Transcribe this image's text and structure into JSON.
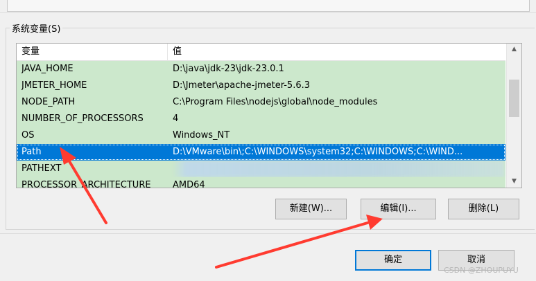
{
  "group_label": "系统变量(S)",
  "columns": {
    "variable": "变量",
    "value": "值"
  },
  "rows": [
    {
      "name": "JAVA_HOME",
      "value": "D:\\java\\jdk-23\\jdk-23.0.1",
      "selected": false
    },
    {
      "name": "JMETER_HOME",
      "value": "D:\\Jmeter\\apache-jmeter-5.6.3",
      "selected": false
    },
    {
      "name": "NODE_PATH",
      "value": "C:\\Program Files\\nodejs\\global\\node_modules",
      "selected": false
    },
    {
      "name": "NUMBER_OF_PROCESSORS",
      "value": "4",
      "selected": false
    },
    {
      "name": "OS",
      "value": "Windows_NT",
      "selected": false
    },
    {
      "name": "Path",
      "value": "D:\\VMware\\bin\\;C:\\WINDOWS\\system32;C:\\WINDOWS;C:\\WIND...",
      "selected": true
    },
    {
      "name": "PATHEXT",
      "value": "",
      "selected": false
    },
    {
      "name": "PROCESSOR_ARCHITECTURE",
      "value": "AMD64",
      "selected": false
    }
  ],
  "buttons": {
    "new": "新建(W)...",
    "edit": "编辑(I)...",
    "delete": "删除(L)",
    "ok": "确定",
    "cancel": "取消"
  },
  "watermark": "CSDN @ZHOUPUYU",
  "colors": {
    "row_bg": "#cce8cc",
    "selected_bg": "#0078d7",
    "arrow": "#ff3b30"
  }
}
